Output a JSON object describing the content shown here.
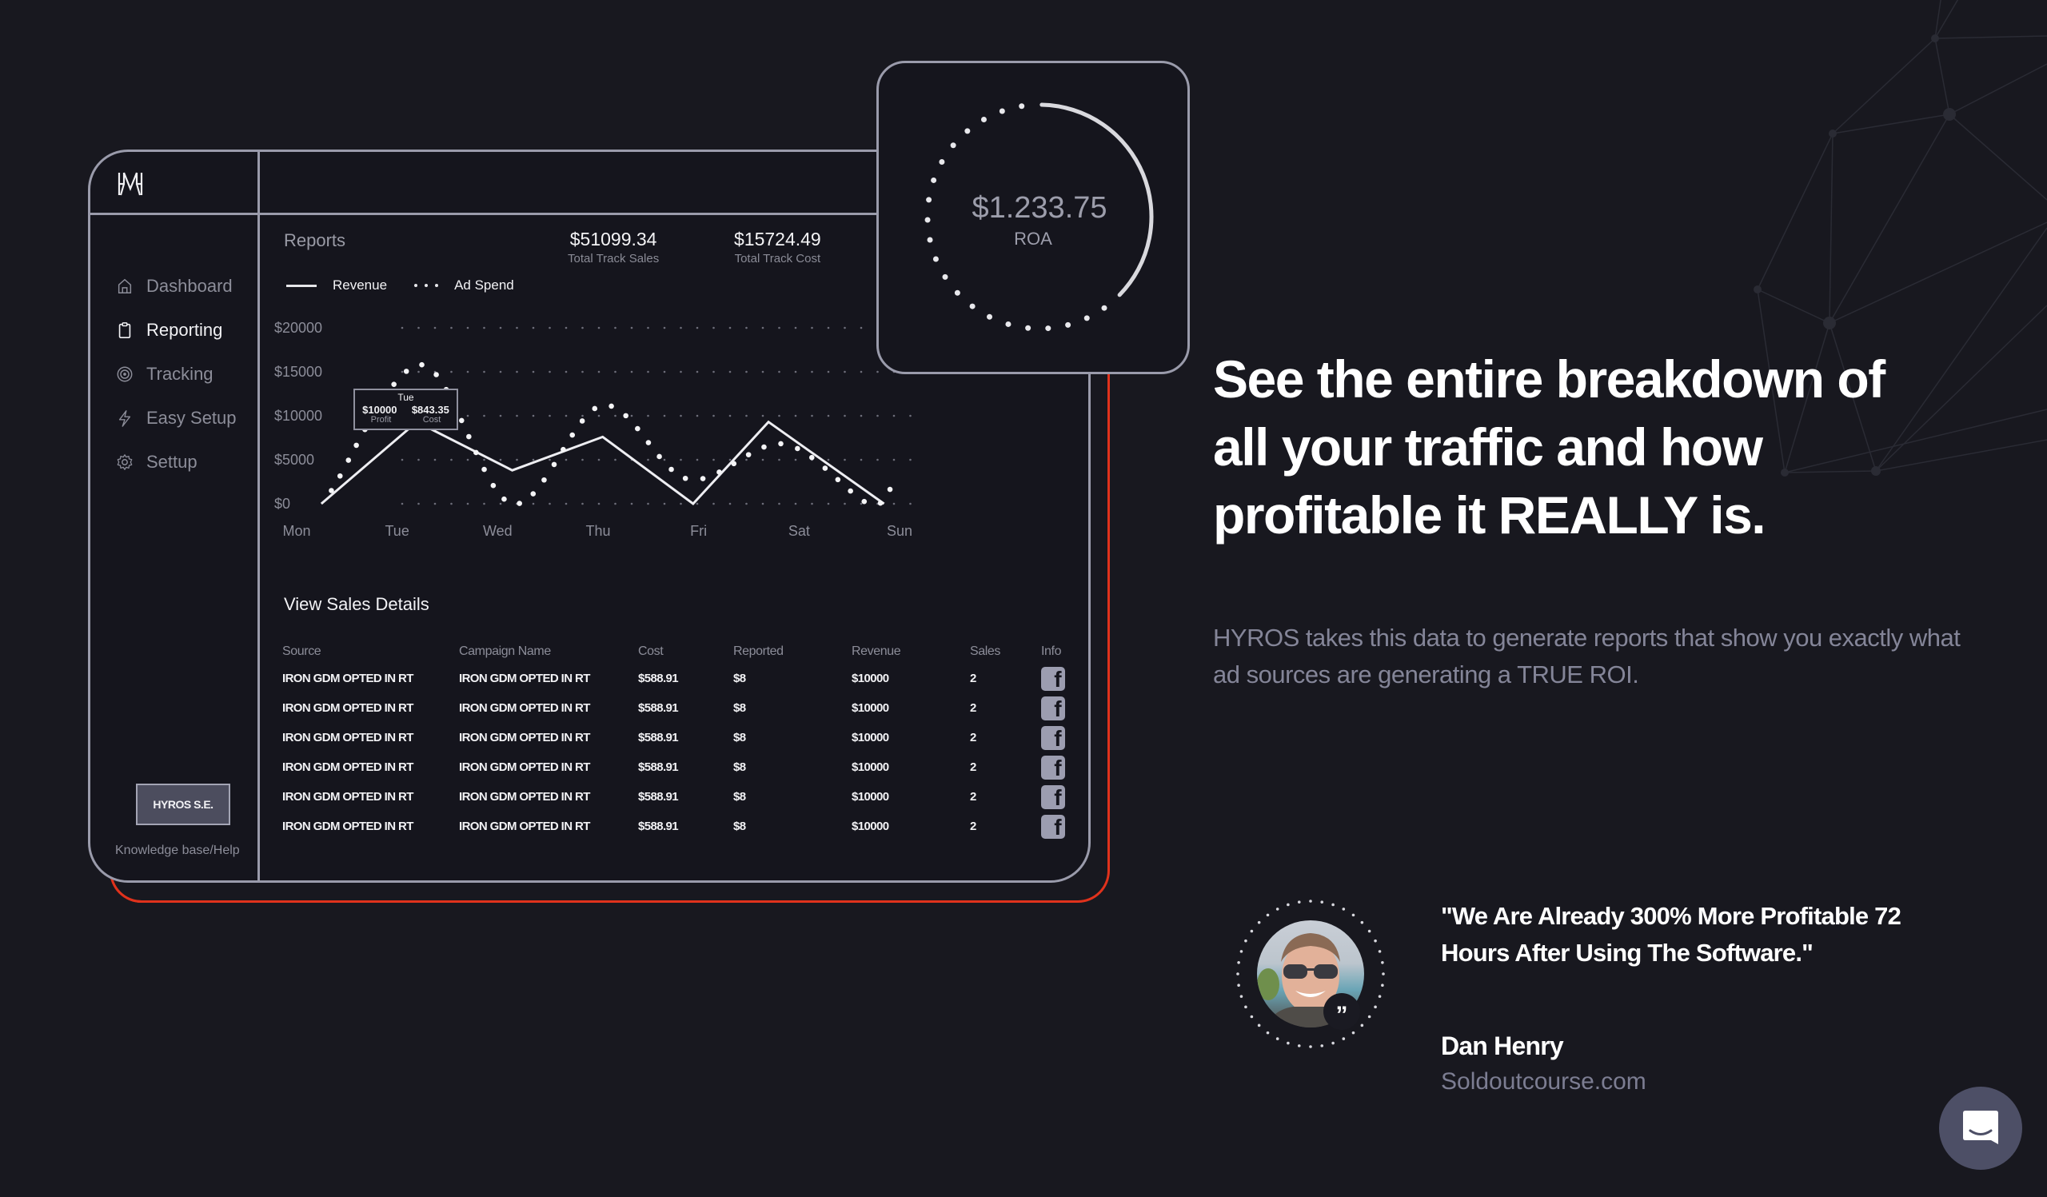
{
  "app": {
    "brand": "HYROS",
    "logo_icon": "hyros-logo-icon"
  },
  "sidebar": {
    "items": [
      {
        "label": "Dashboard",
        "icon": "home-icon",
        "active": false
      },
      {
        "label": "Reporting",
        "icon": "clipboard-icon",
        "active": true
      },
      {
        "label": "Tracking",
        "icon": "target-icon",
        "active": false
      },
      {
        "label": "Easy Setup",
        "icon": "lightning-icon",
        "active": false
      },
      {
        "label": "Settup",
        "icon": "gear-icon",
        "active": false
      }
    ],
    "account_button": "HYROS S.E.",
    "help_link": "Knowledge base/Help"
  },
  "reports": {
    "title": "Reports",
    "stats": [
      {
        "value": "$51099.34",
        "label": "Total Track Sales"
      },
      {
        "value": "$15724.49",
        "label": "Total Track Cost"
      }
    ],
    "legend": {
      "revenue": "Revenue",
      "ad_spend": "Ad Spend"
    },
    "tooltip": {
      "day": "Tue",
      "profit_value": "$10000",
      "profit_label": "Profit",
      "cost_value": "$843.35",
      "cost_label": "Cost"
    }
  },
  "chart_data": {
    "type": "line",
    "title": "",
    "xlabel": "",
    "ylabel": "",
    "categories": [
      "Mon",
      "Tue",
      "Wed",
      "Thu",
      "Fri",
      "Sat",
      "Sun"
    ],
    "y_ticks": [
      "$0",
      "$5000",
      "$10000",
      "$15000",
      "$20000"
    ],
    "y_tick_values": [
      0,
      5000,
      10000,
      15000,
      20000
    ],
    "ylim": [
      0,
      20000
    ],
    "grid": "dotted-horizontal",
    "legend_position": "top-left",
    "series": [
      {
        "name": "Revenue",
        "style": "solid",
        "x": [
          0.15,
          1.1,
          2.05,
          2.95,
          3.85,
          4.6,
          5.75
        ],
        "values": [
          0,
          9300,
          3800,
          7600,
          0,
          9300,
          0
        ]
      },
      {
        "name": "Ad Spend",
        "style": "dotted",
        "x": [
          0.25,
          1.15,
          2.05,
          2.95,
          3.8,
          4.75,
          5.6,
          5.85
        ],
        "values": [
          1500,
          15800,
          0,
          11200,
          2800,
          6800,
          0,
          2600
        ]
      }
    ]
  },
  "sales_details": {
    "title": "View Sales Details",
    "columns": [
      "Source",
      "Campaign Name",
      "Cost",
      "Reported",
      "Revenue",
      "Sales",
      "Info"
    ],
    "rows": [
      {
        "source": "IRON GDM OPTED IN RT",
        "campaign": "IRON GDM OPTED IN RT",
        "cost": "$588.91",
        "reported": "$8",
        "revenue": "$10000",
        "sales": "2",
        "info_icon": "facebook-icon"
      },
      {
        "source": "IRON GDM OPTED IN RT",
        "campaign": "IRON GDM OPTED IN RT",
        "cost": "$588.91",
        "reported": "$8",
        "revenue": "$10000",
        "sales": "2",
        "info_icon": "facebook-icon"
      },
      {
        "source": "IRON GDM OPTED IN RT",
        "campaign": "IRON GDM OPTED IN RT",
        "cost": "$588.91",
        "reported": "$8",
        "revenue": "$10000",
        "sales": "2",
        "info_icon": "facebook-icon"
      },
      {
        "source": "IRON GDM OPTED IN RT",
        "campaign": "IRON GDM OPTED IN RT",
        "cost": "$588.91",
        "reported": "$8",
        "revenue": "$10000",
        "sales": "2",
        "info_icon": "facebook-icon"
      },
      {
        "source": "IRON GDM OPTED IN RT",
        "campaign": "IRON GDM OPTED IN RT",
        "cost": "$588.91",
        "reported": "$8",
        "revenue": "$10000",
        "sales": "2",
        "info_icon": "facebook-icon"
      },
      {
        "source": "IRON GDM OPTED IN RT",
        "campaign": "IRON GDM OPTED IN RT",
        "cost": "$588.91",
        "reported": "$8",
        "revenue": "$10000",
        "sales": "2",
        "info_icon": "facebook-icon"
      }
    ]
  },
  "roa_card": {
    "value": "$1.233.75",
    "label": "ROA",
    "progress_fraction": 0.37
  },
  "marketing": {
    "headline": "See the entire breakdown of all your traffic and how profitable it REALLY is.",
    "headline_lines": [
      "See the entire breakdown of",
      "all your traffic and how",
      "profitable it REALLY is."
    ],
    "description": "HYROS takes this data to generate reports that show you exactly what ad sources are generating a TRUE ROI."
  },
  "testimonial": {
    "quote": "\"We Are Already 300% More Profitable 72 Hours After Using The Software.\"",
    "author": "Dan Henry",
    "company": "Soldoutcourse.com",
    "avatar_icon": "avatar-photo",
    "badge_icon": "quote-icon",
    "badge_glyph": "”"
  },
  "chat_widget": {
    "icon": "chat-bubble-icon"
  },
  "colors": {
    "background": "#18181f",
    "panel": "#15151d",
    "border": "#9a9bab",
    "accent_red": "#e0321c",
    "muted_text": "#848598"
  }
}
